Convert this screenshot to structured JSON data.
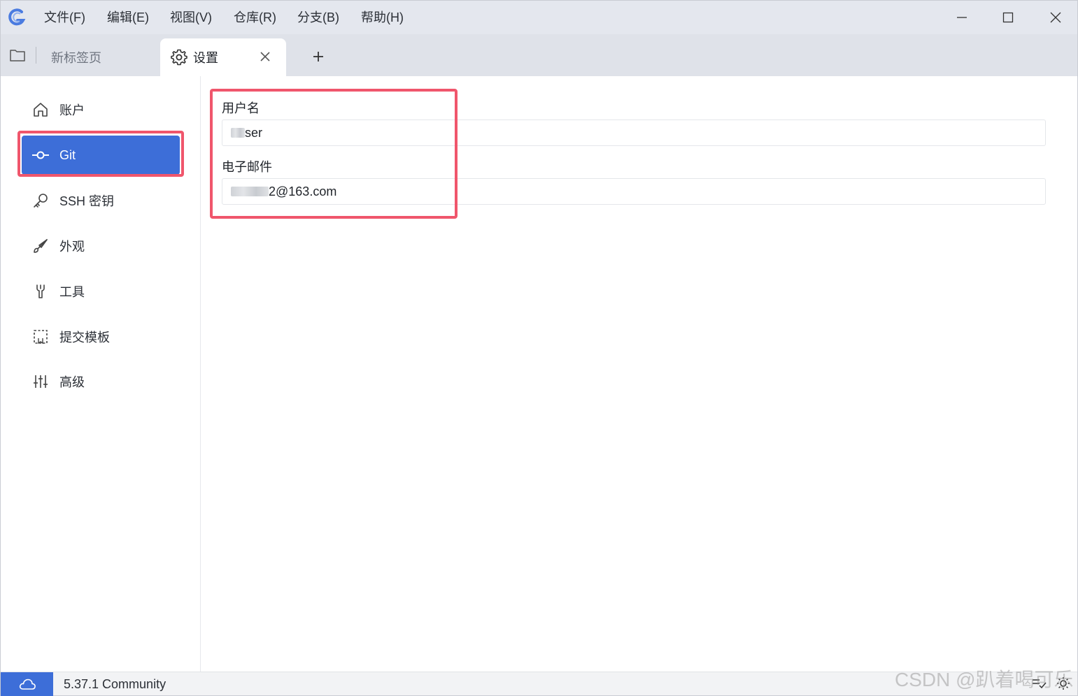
{
  "menu": {
    "items": [
      "文件(F)",
      "编辑(E)",
      "视图(V)",
      "仓库(R)",
      "分支(B)",
      "帮助(H)"
    ]
  },
  "tabs": {
    "inactive_label": "新标签页",
    "active_label": "设置"
  },
  "sidebar": {
    "items": [
      {
        "label": "账户",
        "icon": "home-icon"
      },
      {
        "label": "Git",
        "icon": "git-commit-icon"
      },
      {
        "label": "SSH 密钥",
        "icon": "key-icon"
      },
      {
        "label": "外观",
        "icon": "brush-icon"
      },
      {
        "label": "工具",
        "icon": "wrench-icon"
      },
      {
        "label": "提交模板",
        "icon": "template-icon"
      },
      {
        "label": "高级",
        "icon": "sliders-icon"
      }
    ],
    "active_index": 1
  },
  "form": {
    "username_label": "用户名",
    "username_value_visible": "ser",
    "email_label": "电子邮件",
    "email_value_visible": "2@163.com"
  },
  "status": {
    "version": "5.37.1 Community"
  },
  "watermark": "CSDN @趴着喝可乐",
  "colors": {
    "accent": "#3d6ed8",
    "highlight": "#f0566c",
    "background": "#e4e7ee"
  }
}
